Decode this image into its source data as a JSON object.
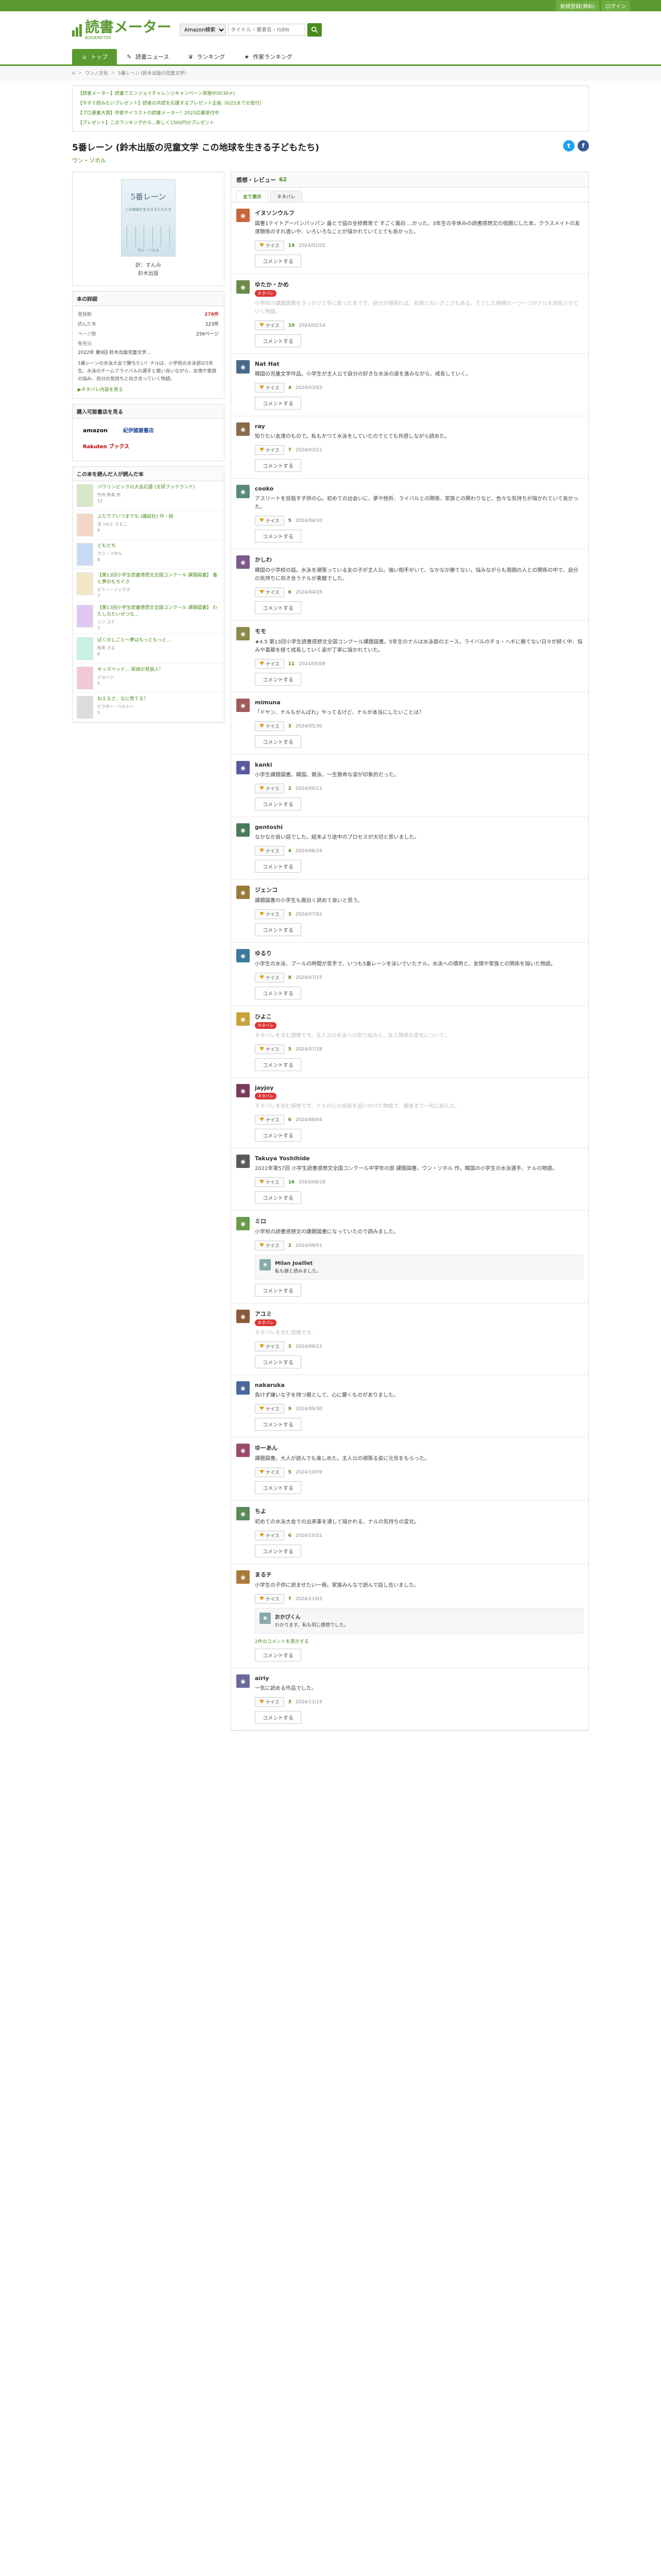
{
  "topbar": {
    "signup": "新規登録(無料)",
    "login": "ログイン"
  },
  "header": {
    "logo": "読書メーター",
    "logo_sub": "BOOKMETER",
    "search_category": "Amazon検索",
    "search_placeholder": "タイトル・著者名・ISBN"
  },
  "nav": [
    {
      "label": "トップ",
      "icon": "⌂"
    },
    {
      "label": "読書ニュース",
      "icon": "✎"
    },
    {
      "label": "ランキング",
      "icon": "♛"
    },
    {
      "label": "作家ランキング",
      "icon": "★"
    }
  ],
  "breadcrumb": [
    "ワンノ文化",
    "5番レーン (鈴木出版の児童文学)"
  ],
  "notices": [
    "【読者メーター】読書でエンジョイチャレンジキャンペーン実施中(6/30〆)",
    "【今すぐ読みたいプレゼント】読者の共読を応援するプレゼント企画（6/25までの受付）",
    "【プロ選書大賞】作家やイラストの読書メーター！2025応募受付中",
    "【プレゼント】このランキングから...新しく1500円分プレゼント"
  ],
  "book": {
    "title": "5番レーン (鈴木出版の児童文学 この地球を生きる子どもたち)",
    "author": "ウン・ソホル",
    "cover_title": "5番レーン",
    "cover_sub": "この地球を生きる子どもたち",
    "meta_author": "ウン・ソホル",
    "meta_translator": "訳：すんみ",
    "meta_publisher": "鈴木出版"
  },
  "data_panel": {
    "heading": "本の詳細",
    "rows": [
      {
        "k": "登録数",
        "v": "278件"
      },
      {
        "k": "読んだ本",
        "v": "223件"
      },
      {
        "k": "ページ数",
        "v": "256ページ"
      }
    ],
    "release": "発売日",
    "release_v": "2022年 第9回 鈴木出版児童文学...",
    "desc": "5番レーンの水泳大会で勝ちたい！ナルは、小学校の水泳部の5年生。水泳のチームでライバルの選手と競い合いながら、友情や家族の悩み、自分の気持ちと向き合っていく物語。",
    "more": "▶ネタバレ内容を見る"
  },
  "stores": {
    "heading": "購入可能書店を見る",
    "amazon": "amazon",
    "kino": "紀伊國屋書店",
    "rakuten": "Rakuten ブックス"
  },
  "related": {
    "heading": "この本を読んだ人が読んだ本",
    "items": [
      {
        "title": "パラリンピックの大会応援 (文研ブックランド)",
        "author": "竹内 希美 他",
        "count": "12"
      },
      {
        "title": "ふたりでいつまでも (講談社) 作・絵",
        "author": "まつもと さえこ",
        "count": "9"
      },
      {
        "title": "どもだち",
        "author": "ウン・ソホル",
        "count": "8"
      },
      {
        "title": "【第13回小学生読書感想文全国コンクール 課題図書】 書と夢のもちぐさ",
        "author": "ビミー・ノックス",
        "count": "7"
      },
      {
        "title": "【第13回小学生読書感想文全国コンクール 課題図書】 わたしのたいせつな...",
        "author": "ソン ユナ",
        "count": "7"
      },
      {
        "title": "ぼくのしごと～夢はもっともっと...",
        "author": "松本 さよ",
        "count": "6"
      },
      {
        "title": "キッズベッド... 探偵が見張人！",
        "author": "ジョハン",
        "count": "5"
      },
      {
        "title": "ねえるさ、なに見てる？",
        "author": "ビクター・ベルトー",
        "count": "5"
      }
    ]
  },
  "reviews_panel": {
    "heading": "感想・レビュー",
    "count": "62",
    "tabs": [
      "全て表示",
      "ネタバレ"
    ]
  },
  "labels": {
    "like": "ナイス",
    "comment": "コメントする",
    "netabare": "ネタバレ"
  },
  "reviews": [
    {
      "name": "イヌソンウルフ",
      "badge": "",
      "text": "図書1テイトアーバンパッパン 最とで協の全修教育で すごく面白 ...かった。3年生の冬休みの読書感想文の宿題にした本。クラスメイトの友達関係のすれ違いや、いろいろなことが描かれていてとても良かった。",
      "likes": "14",
      "date": "2024/01/02",
      "color": "#c7663a"
    },
    {
      "name": "ゆたか・かめ",
      "badge": "ネタバレ",
      "text": "小学校の課題図書をきっかけで手に取った本です。自分が頑張れば、友達とのいざこざもある。そうした経験の一つ一つがナルを成長させていく物語。",
      "likes": "10",
      "date": "2024/02/14",
      "color": "#6a8a4a",
      "netabare": true
    },
    {
      "name": "Nat Hat",
      "badge": "",
      "text": "韓国の児童文学作品。小学生が主人公で自分の好きな水泳の道を進みながら、成長していく。",
      "likes": "4",
      "date": "2024/03/03",
      "color": "#4a6a8a"
    },
    {
      "name": "ray",
      "badge": "",
      "text": "知りたい友達のもので。私もかつて水泳をしていたのでとても共感しながら読めた。",
      "likes": "7",
      "date": "2024/03/21",
      "color": "#8a6a4a"
    },
    {
      "name": "cooko",
      "badge": "",
      "text": "アスリートを目指す子供の心。初めての出会いに、夢や挫折、ライバルとの関係、家族との関わりなど、色々な気持ちが描かれていて良かった。",
      "likes": "5",
      "date": "2024/04/10",
      "color": "#5a8a7a"
    },
    {
      "name": "かしわ",
      "badge": "",
      "text": "韓国の小学校の話。水泳を頑張っている女の子が主人公。強い相手がいて、なかなか勝てない。悩みながらも周囲の人との関係の中で、自分の気持ちに向き合うナルが素敵でした。",
      "likes": "6",
      "date": "2024/04/28",
      "color": "#7a5a8a"
    },
    {
      "name": "モモ",
      "badge": "",
      "text": "★4.5 第13回小学生読書感想文全国コンクール課題図書。5年生のナルは水泳部のエース。ライバルのチョ・ヘギに勝てない日々が続く中、悩みや葛藤を経て成長していく姿が丁寧に描かれていた。",
      "likes": "11",
      "date": "2024/05/09",
      "color": "#8a8a4a"
    },
    {
      "name": "mimuna",
      "badge": "",
      "text": "「ドヤン、ナルもがんばれ」やってるけど、ナルが本当にしたいことは？",
      "likes": "3",
      "date": "2024/05/30",
      "color": "#a05a5a"
    },
    {
      "name": "kanki",
      "badge": "",
      "text": "小学生課題図書。韓国。競泳。一生懸命な姿が印象的だった。",
      "likes": "2",
      "date": "2024/06/11",
      "color": "#5a5aa0"
    },
    {
      "name": "gentoshi",
      "badge": "",
      "text": "なかなか良い話でした。結末より途中のプロセスが大切と思いました。",
      "likes": "4",
      "date": "2024/06/19",
      "color": "#4a7a5a"
    },
    {
      "name": "ジェンコ",
      "badge": "",
      "text": "課題図書の小学生も面白く読めて良いと思う。",
      "likes": "3",
      "date": "2024/07/02",
      "color": "#9a7a3a"
    },
    {
      "name": "ゆるり",
      "badge": "",
      "text": "小学生の水泳、プールの時間が苦手で、いつも5番レーンを泳いでいたナル。水泳への情熱と、友情や家族との関係を描いた物語。",
      "likes": "8",
      "date": "2024/07/15",
      "color": "#3a7a9a"
    },
    {
      "name": "ひよこ",
      "badge": "ネタバレ",
      "text": "ネタバレを含む感想です。主人公の水泳への取り組みと、友人関係の変化について。",
      "likes": "5",
      "date": "2024/07/28",
      "color": "#c9a23a",
      "netabare": true
    },
    {
      "name": "jayjoy",
      "badge": "ネタバレ",
      "text": "ネタバレを含む感想です。ナルの心の成長を追いかけた物語で、最後まで一気に読んだ。",
      "likes": "6",
      "date": "2024/08/04",
      "color": "#7a3a5a",
      "netabare": true
    },
    {
      "name": "Takuya Yoshihide",
      "badge": "",
      "text": "2022年第57回 小学生読書感想文全国コンクール中学年の部 課題図書。ウン・ソホル 作。韓国の小学生の水泳選手、ナルの物語。",
      "likes": "16",
      "date": "2024/08/18",
      "color": "#5a5a5a"
    },
    {
      "name": "ミロ",
      "badge": "",
      "text": "小学校の読書感想文の課題図書になっていたので読みました。",
      "likes": "2",
      "date": "2024/09/01",
      "color": "#6a9a4a",
      "reply": {
        "name": "Milan Joaillet",
        "text": "私も娘と読みました。"
      }
    },
    {
      "name": "アユミ",
      "badge": "ネタバレ",
      "text": "ネタバレを含む感想です。",
      "likes": "3",
      "date": "2024/09/12",
      "color": "#8a5a3a",
      "netabare": true
    },
    {
      "name": "nakaruka",
      "badge": "",
      "text": "負けず嫌いな子を持つ親として、心に響くものがありました。",
      "likes": "9",
      "date": "2024/09/30",
      "color": "#4a6a9a"
    },
    {
      "name": "ゆーあん",
      "badge": "",
      "text": "課題図書。大人が読んでも楽しめた。主人公の頑張る姿に元気をもらった。",
      "likes": "5",
      "date": "2024/10/09",
      "color": "#9a4a6a"
    },
    {
      "name": "ちよ",
      "badge": "",
      "text": "初めての水泳大会での出来事を通して描かれる、ナルの気持ちの変化。",
      "likes": "6",
      "date": "2024/10/21",
      "color": "#5a8a5a"
    },
    {
      "name": "まるチ",
      "badge": "",
      "text": "小学生の子供に読ませたい一冊。家族みんなで読んで話し合いました。",
      "likes": "7",
      "date": "2024/11/03",
      "color": "#aa7a3a",
      "reply": {
        "name": "おかぴくん",
        "text": "わかります。私も同じ感想でした。"
      },
      "more": "2件のコメントを表示する"
    },
    {
      "name": "airiy",
      "badge": "",
      "text": "一気に読める作品でした。",
      "likes": "3",
      "date": "2024/11/19",
      "color": "#6a6a9a"
    }
  ]
}
